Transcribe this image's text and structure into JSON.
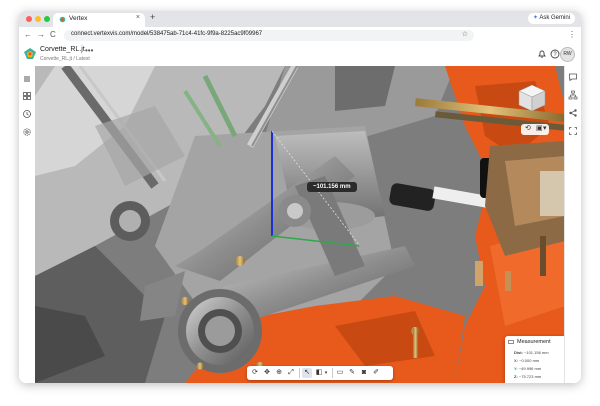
{
  "browser": {
    "tab_title": "Vertex",
    "new_tab": "+",
    "tab_close": "×",
    "gemini_button": "Ask Gemini",
    "back": "←",
    "forward": "→",
    "reload": "C",
    "url": "connect.vertexvis.com/model/538475ab-71c4-41fc-9f9a-8225ac9f09967",
    "star": "☆",
    "menu": "⋮"
  },
  "app": {
    "doc_title": "Corvette_RL.jt",
    "doc_subtitle": "Corvette_RL.jt / Latest",
    "more": "•••",
    "avatar_initials": "RW"
  },
  "viewport": {
    "measurement_label": "~101.156 mm"
  },
  "measurement_panel": {
    "title": "Measurement",
    "help": "?",
    "rows": [
      {
        "key": "Dist:",
        "value": "~101.156 mm"
      },
      {
        "key": "X:",
        "value": "~0.000 mm"
      },
      {
        "key": "Y:",
        "value": "~49.996 mm"
      },
      {
        "key": "Z:",
        "value": "~75.723 mm"
      }
    ]
  },
  "colors": {
    "engine_orange": "#e85a1b",
    "measure_blue": "#1a2fd6",
    "measure_green": "#2fa84a",
    "panel_dark": "#2b2b2b"
  },
  "icons": {
    "left_sidebar": [
      "list-icon",
      "grid-icon",
      "history-icon",
      "settings-icon"
    ],
    "right_sidebar": [
      "comment-icon",
      "hierarchy-icon",
      "share-icon",
      "fit-icon"
    ],
    "toolbar": [
      "rotate-icon",
      "pan-icon",
      "zoom-icon",
      "fit-icon",
      "select-icon",
      "cross-section-icon",
      "measure-icon",
      "pen-icon",
      "camera-icon",
      "markup-icon"
    ]
  }
}
